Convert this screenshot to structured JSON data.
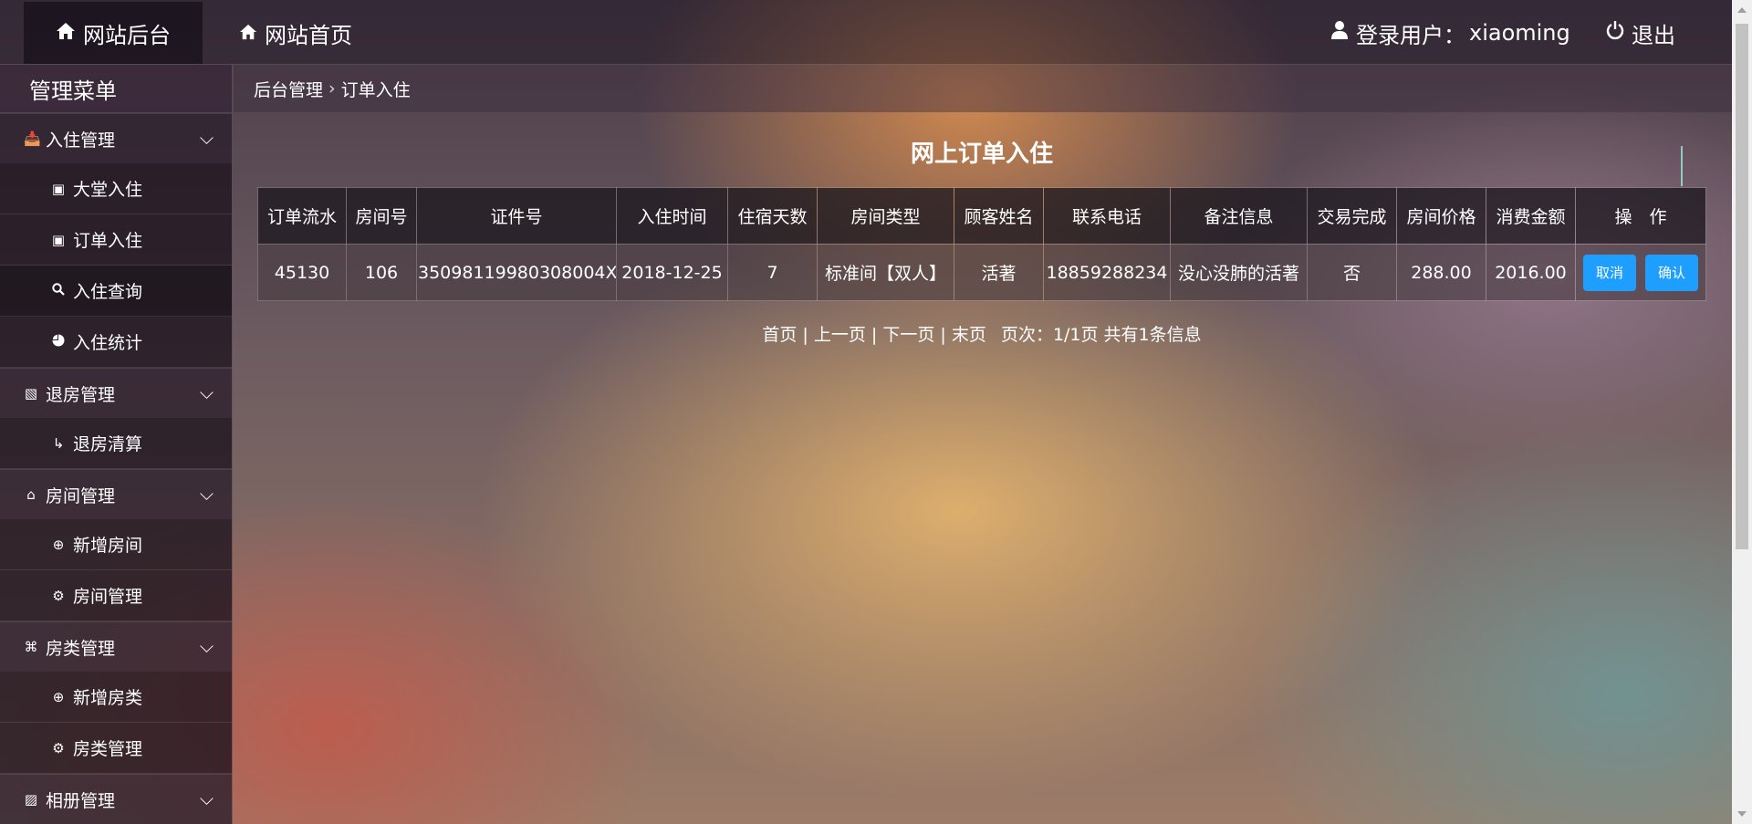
{
  "topbar": {
    "brand": "网站后台",
    "home": "网站首页",
    "user_label": "登录用户：",
    "username": "xiaoming",
    "logout": "退出"
  },
  "sidebar": {
    "title": "管理菜单",
    "groups": [
      {
        "label": "入住管理",
        "icon": "inbox-icon",
        "items": [
          {
            "label": "大堂入住",
            "icon": "doc-icon"
          },
          {
            "label": "订单入住",
            "icon": "doc-icon"
          },
          {
            "label": "入住查询",
            "icon": "search-icon",
            "active": true
          },
          {
            "label": "入住统计",
            "icon": "pie-chart-icon"
          }
        ]
      },
      {
        "label": "退房管理",
        "icon": "checkout-icon",
        "items": [
          {
            "label": "退房清算",
            "icon": "exit-icon"
          }
        ]
      },
      {
        "label": "房间管理",
        "icon": "house-icon",
        "items": [
          {
            "label": "新增房间",
            "icon": "plus-circle-icon"
          },
          {
            "label": "房间管理",
            "icon": "gear-icon"
          }
        ]
      },
      {
        "label": "房类管理",
        "icon": "command-icon",
        "items": [
          {
            "label": "新增房类",
            "icon": "plus-circle-icon"
          },
          {
            "label": "房类管理",
            "icon": "gear-icon"
          }
        ]
      },
      {
        "label": "相册管理",
        "icon": "image-icon",
        "items": []
      }
    ]
  },
  "breadcrumb": {
    "root": "后台管理",
    "current": "订单入住"
  },
  "main": {
    "title": "网上订单入住",
    "table": {
      "headers": [
        "订单流水",
        "房间号",
        "证件号",
        "入住时间",
        "住宿天数",
        "房间类型",
        "顾客姓名",
        "联系电话",
        "备注信息",
        "交易完成",
        "房间价格",
        "消费金额",
        "操　作"
      ],
      "rows": [
        [
          "45130",
          "106",
          "35098119980308004X",
          "2018-12-25",
          "7",
          "标准间【双人】",
          "活著",
          "18859288234",
          "没心没肺的活著",
          "否",
          "288.00",
          "2016.00"
        ]
      ],
      "cancel_label": "取消",
      "confirm_label": "确认"
    },
    "pager": {
      "first": "首页",
      "prev": "上一页",
      "next": "下一页",
      "last": "末页",
      "info": "页次：1/1页 共有1条信息"
    }
  },
  "colors": {
    "accent": "#1e9fff"
  }
}
